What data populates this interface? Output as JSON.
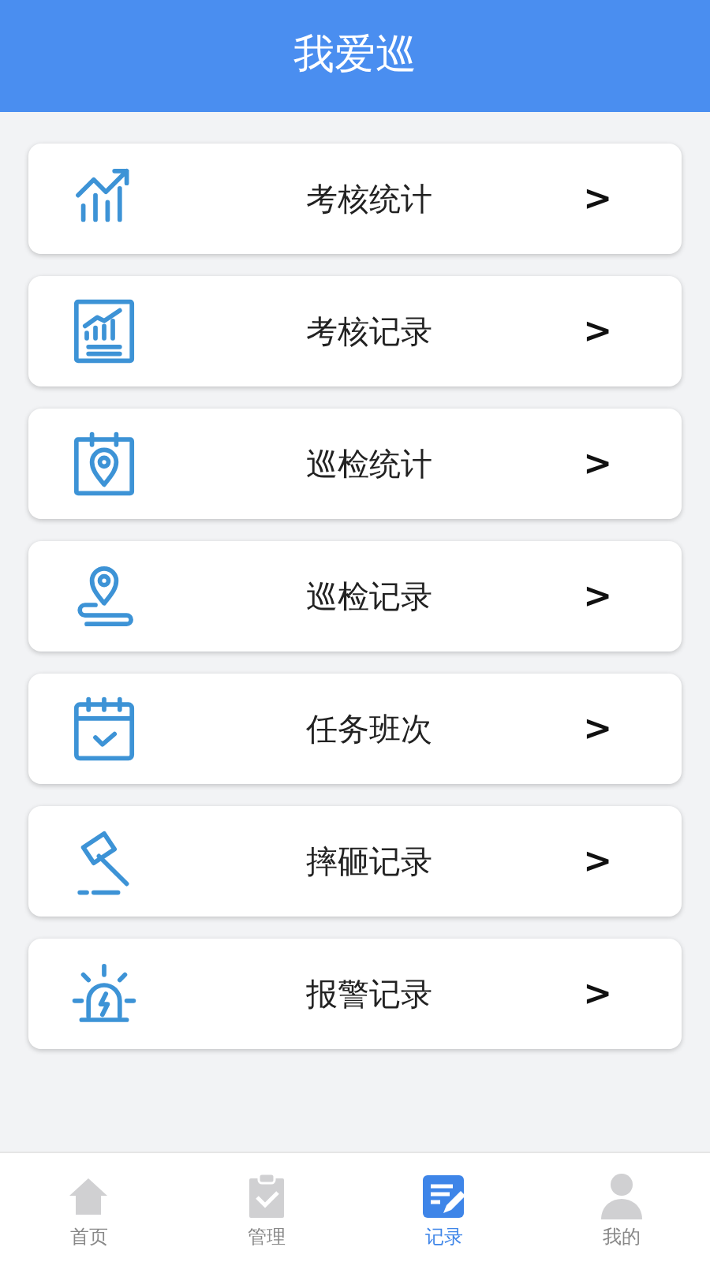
{
  "header": {
    "title": "我爱巡"
  },
  "menu": [
    {
      "label": "考核统计",
      "chevron": ">"
    },
    {
      "label": "考核记录",
      "chevron": ">"
    },
    {
      "label": "巡检统计",
      "chevron": ">"
    },
    {
      "label": "巡检记录",
      "chevron": ">"
    },
    {
      "label": "任务班次",
      "chevron": ">"
    },
    {
      "label": "摔砸记录",
      "chevron": ">"
    },
    {
      "label": "报警记录",
      "chevron": ">"
    }
  ],
  "tab_bar": [
    {
      "label": "首页",
      "selected": false
    },
    {
      "label": "管理",
      "selected": false
    },
    {
      "label": "记录",
      "selected": true
    },
    {
      "label": "我的",
      "selected": false
    }
  ]
}
